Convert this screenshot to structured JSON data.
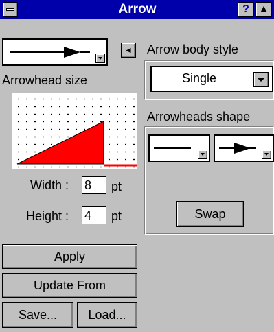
{
  "window": {
    "title": "Arrow",
    "help_label": "?",
    "roll_label": "▲"
  },
  "left": {
    "collapse_label": "◄",
    "arrowhead_size_label": "Arrowhead size",
    "width_label": "Width :",
    "width_value": "8",
    "width_unit": "pt",
    "height_label": "Height :",
    "height_value": "4",
    "height_unit": "pt"
  },
  "buttons": {
    "apply": "Apply",
    "update_from": "Update From",
    "save": "Save...",
    "load": "Load..."
  },
  "right": {
    "body_style_label": "Arrow body style",
    "body_style_value": "Single",
    "heads_shape_label": "Arrowheads shape",
    "swap": "Swap"
  },
  "colors": {
    "titlebar": "#0000aa",
    "face": "#c0c0c0",
    "arrowhead_fill": "#ff0000"
  },
  "icons": [
    "system-menu-icon",
    "help-icon",
    "roll-up-icon",
    "arrow-line-icon",
    "arrowhead-icon",
    "plain-line-icon",
    "collapse-left-icon"
  ]
}
